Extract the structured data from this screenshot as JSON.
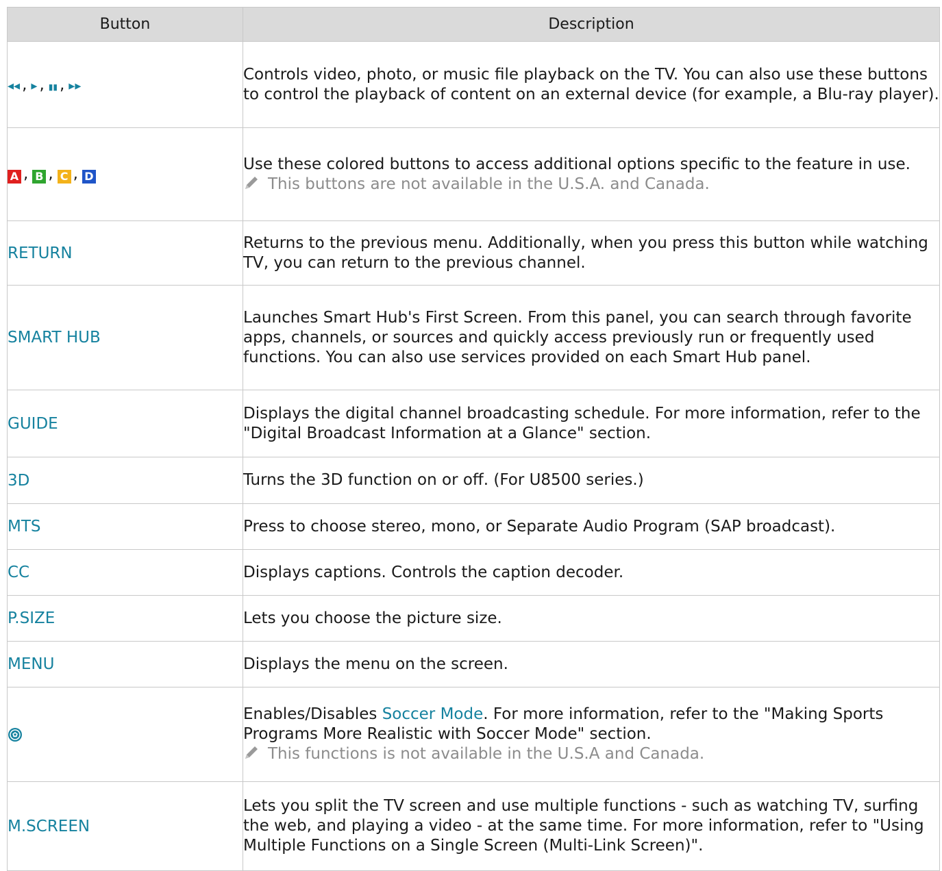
{
  "header": {
    "button": "Button",
    "description": "Description"
  },
  "rows": [
    {
      "playback_symbols": [
        "◂◂",
        "▸",
        "▮▮",
        "▸▸"
      ],
      "description": "Controls video, photo, or music file playback on the TV. You can also use these buttons to control the playback of content on an external device (for example, a Blu-ray player)."
    },
    {
      "color_keys": [
        {
          "label": "A",
          "color": "#e0201f"
        },
        {
          "label": "B",
          "color": "#2fa52f"
        },
        {
          "label": "C",
          "color": "#f3b21a"
        },
        {
          "label": "D",
          "color": "#1f55c8"
        }
      ],
      "description": "Use these colored buttons to access additional options specific to the feature in use.",
      "note": "This buttons are not available in the U.S.A. and Canada."
    },
    {
      "button": "RETURN",
      "description": "Returns to the previous menu. Additionally, when you press this button while watching TV, you can return to the previous channel."
    },
    {
      "button": "SMART HUB",
      "description": "Launches Smart Hub's First Screen. From this panel, you can search through favorite apps, channels, or sources and quickly access previously run or frequently used functions. You can also use services provided on each Smart Hub panel."
    },
    {
      "button": "GUIDE",
      "description": "Displays the digital channel broadcasting schedule. For more information, refer to the \"Digital Broadcast Information at a Glance\" section."
    },
    {
      "button": "3D",
      "description": "Turns the 3D function on or off. (For U8500 series.)"
    },
    {
      "button": "MTS",
      "description": "Press to choose stereo, mono, or Separate Audio Program (SAP broadcast)."
    },
    {
      "button": "CC",
      "description": "Displays captions. Controls the caption decoder."
    },
    {
      "button": "P.SIZE",
      "description": "Lets you choose the picture size."
    },
    {
      "button": "MENU",
      "description": "Displays the menu on the screen."
    },
    {
      "button_icon": "soccer-ball-icon",
      "description_pre": "Enables/Disables ",
      "description_link": "Soccer Mode",
      "description_post": ". For more information, refer to the \"Making Sports Programs More Realistic with Soccer Mode\" section.",
      "note": "This functions is not available in the U.S.A and Canada."
    },
    {
      "button": "M.SCREEN",
      "description": "Lets you split the TV screen and use multiple functions - such as watching TV, surfing the web, and playing a video - at the same time. For more information, refer to \"Using Multiple Functions on a Single Screen (Multi-Link Screen)\"."
    }
  ],
  "icons": {
    "note": "pencil-icon"
  },
  "colors": {
    "accent": "#16829f",
    "note_text": "#8c8c8c",
    "header_bg": "#dadada",
    "border": "#c8c8c8"
  }
}
